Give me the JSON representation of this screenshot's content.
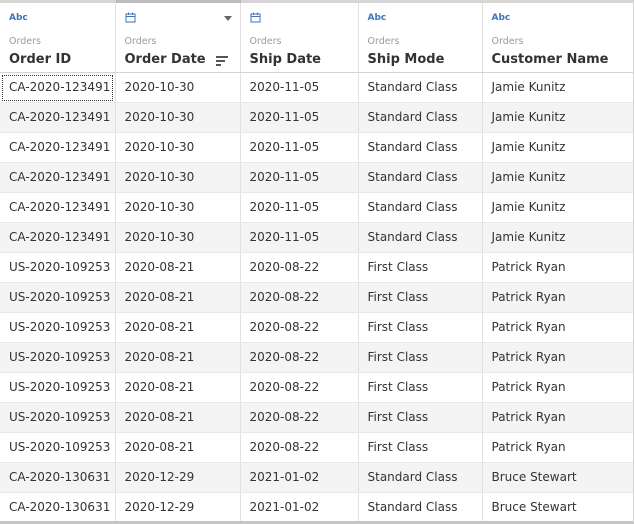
{
  "columns": [
    {
      "type_label": "Abc",
      "type": "string",
      "source": "Orders",
      "name": "Order ID"
    },
    {
      "type_label": "",
      "type": "date",
      "source": "Orders",
      "name": "Order Date"
    },
    {
      "type_label": "",
      "type": "date",
      "source": "Orders",
      "name": "Ship Date"
    },
    {
      "type_label": "Abc",
      "type": "string",
      "source": "Orders",
      "name": "Ship Mode"
    },
    {
      "type_label": "Abc",
      "type": "string",
      "source": "Orders",
      "name": "Customer Name"
    }
  ],
  "rows": [
    [
      "CA-2020-123491",
      "2020-10-30",
      "2020-11-05",
      "Standard Class",
      "Jamie Kunitz"
    ],
    [
      "CA-2020-123491",
      "2020-10-30",
      "2020-11-05",
      "Standard Class",
      "Jamie Kunitz"
    ],
    [
      "CA-2020-123491",
      "2020-10-30",
      "2020-11-05",
      "Standard Class",
      "Jamie Kunitz"
    ],
    [
      "CA-2020-123491",
      "2020-10-30",
      "2020-11-05",
      "Standard Class",
      "Jamie Kunitz"
    ],
    [
      "CA-2020-123491",
      "2020-10-30",
      "2020-11-05",
      "Standard Class",
      "Jamie Kunitz"
    ],
    [
      "CA-2020-123491",
      "2020-10-30",
      "2020-11-05",
      "Standard Class",
      "Jamie Kunitz"
    ],
    [
      "US-2020-109253",
      "2020-08-21",
      "2020-08-22",
      "First Class",
      "Patrick Ryan"
    ],
    [
      "US-2020-109253",
      "2020-08-21",
      "2020-08-22",
      "First Class",
      "Patrick Ryan"
    ],
    [
      "US-2020-109253",
      "2020-08-21",
      "2020-08-22",
      "First Class",
      "Patrick Ryan"
    ],
    [
      "US-2020-109253",
      "2020-08-21",
      "2020-08-22",
      "First Class",
      "Patrick Ryan"
    ],
    [
      "US-2020-109253",
      "2020-08-21",
      "2020-08-22",
      "First Class",
      "Patrick Ryan"
    ],
    [
      "US-2020-109253",
      "2020-08-21",
      "2020-08-22",
      "First Class",
      "Patrick Ryan"
    ],
    [
      "US-2020-109253",
      "2020-08-21",
      "2020-08-22",
      "First Class",
      "Patrick Ryan"
    ],
    [
      "CA-2020-130631",
      "2020-12-29",
      "2021-01-02",
      "Standard Class",
      "Bruce Stewart"
    ],
    [
      "CA-2020-130631",
      "2020-12-29",
      "2021-01-02",
      "Standard Class",
      "Bruce Stewart"
    ]
  ],
  "sorted_column": "Order Date",
  "selected_cell": {
    "row": 0,
    "col": 0
  },
  "colors": {
    "type_icon": "#3b76b5",
    "header_text": "#333333",
    "source_text": "#9a9a9a",
    "stripe": "#f4f4f4"
  }
}
